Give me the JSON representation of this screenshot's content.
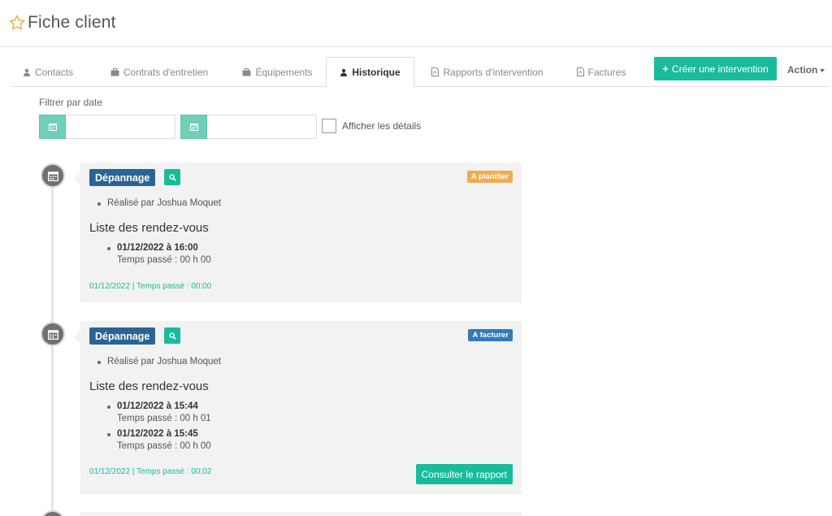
{
  "header": {
    "title": "Fiche client",
    "icon": "star-outline-icon",
    "icon_color": "#f0ad4e"
  },
  "tabs": [
    {
      "label": "Contacts",
      "icon": "user-icon"
    },
    {
      "label": "Contrats d'entretien",
      "icon": "briefcase-icon"
    },
    {
      "label": "Équipements",
      "icon": "briefcase-icon"
    },
    {
      "label": "Historique",
      "icon": "user-icon",
      "active": true
    },
    {
      "label": "Rapports d'intervention",
      "icon": "pdf-file-icon"
    },
    {
      "label": "Factures",
      "icon": "pdf-file-icon"
    }
  ],
  "actions": {
    "create_label": "Créer une intervention",
    "action_label": "Action"
  },
  "filter": {
    "label": "Filtrer par date",
    "start_value": "",
    "end_value": "",
    "details_label": "Afficher les détails",
    "details_checked": false
  },
  "colors": {
    "accent": "#1abb9c",
    "badge_blue": "#2a6496",
    "status_orange": "#f0ad4e",
    "status_blue": "#337ab7"
  },
  "timeline": [
    {
      "type": "Dépannage",
      "status": "A planifier",
      "status_color": "#f0ad4e",
      "realise": "Réalisé par Joshua Moquet",
      "rdv_title": "Liste des rendez-vous",
      "rdvs": [
        {
          "when": "01/12/2022 à 16:00",
          "spent": "Temps passé : 00 h 00"
        }
      ],
      "footer": "01/12/2022 | Temps passé : 00:00"
    },
    {
      "type": "Dépannage",
      "status": "A facturer",
      "status_color": "#337ab7",
      "realise": "Réalisé par Joshua Moquet",
      "rdv_title": "Liste des rendez-vous",
      "rdvs": [
        {
          "when": "01/12/2022 à 15:44",
          "spent": "Temps passé : 00 h 01"
        },
        {
          "when": "01/12/2022 à 15:45",
          "spent": "Temps passé : 00 h 00"
        }
      ],
      "footer": "01/12/2022 | Temps passé : 00:02",
      "report_label": "Consulter le rapport"
    }
  ]
}
